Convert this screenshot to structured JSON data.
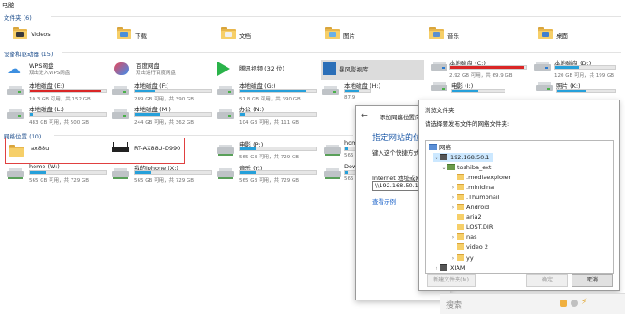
{
  "window": {
    "title_fragment": "电脑"
  },
  "groups": {
    "folders": "文件夹 (6)",
    "devices": "设备和驱动器 (15)",
    "network": "网络位置 (10)"
  },
  "folders": [
    {
      "label": "Videos"
    },
    {
      "label": "下载"
    },
    {
      "label": "文档"
    },
    {
      "label": "图片"
    },
    {
      "label": "音乐"
    },
    {
      "label": "桌面"
    }
  ],
  "apps": [
    {
      "label": "WPS网盘",
      "sub": "双击进入WPS网盘"
    },
    {
      "label": "百度网盘",
      "sub": "双击运行百度网盘"
    },
    {
      "label": "腾讯视频 (32 位)",
      "sub": ""
    },
    {
      "label": "暴风影视库",
      "sub": ""
    }
  ],
  "drives": [
    {
      "label": "本地磁盘 (C:)",
      "sub": "2.92 GB 可用，共 69.9 GB",
      "fill": 0.96,
      "red": true
    },
    {
      "label": "本地磁盘 (D:)",
      "sub": "120 GB 可用，共 199 GB",
      "fill": 0.4,
      "red": false
    },
    {
      "label": "本地磁盘 (E:)",
      "sub": "10.3 GB 可用，共 152 GB",
      "fill": 0.93,
      "red": true
    },
    {
      "label": "本地磁盘 (F:)",
      "sub": "289 GB 可用，共 390 GB",
      "fill": 0.26,
      "red": false
    },
    {
      "label": "本地磁盘 (G:)",
      "sub": "51.8 GB 可用，共 390 GB",
      "fill": 0.87,
      "red": false
    },
    {
      "label": "本地磁盘 (H:)",
      "sub": "87.9",
      "fill": 0.55,
      "red": false
    },
    {
      "label": "电影 (I:)",
      "sub": "",
      "fill": 0.5,
      "red": false
    },
    {
      "label": "照片 (K:)",
      "sub": "",
      "fill": 0.5,
      "red": false
    },
    {
      "label": "本地磁盘 (L:)",
      "sub": "483 GB 可用，共 500 GB",
      "fill": 0.03,
      "red": false
    },
    {
      "label": "本地磁盘 (M:)",
      "sub": "244 GB 可用，共 362 GB",
      "fill": 0.33,
      "red": false
    },
    {
      "label": "办公 (N:)",
      "sub": "104 GB 可用，共 111 GB",
      "fill": 0.06,
      "red": false
    }
  ],
  "network_items": [
    {
      "label": "ax88u"
    },
    {
      "label": "RT-AX88U-D990"
    },
    {
      "label": "电影 (P:)",
      "sub": "565 GB 可用，共 729 GB"
    },
    {
      "label": "home",
      "sub": "565"
    },
    {
      "label": "home (W:)",
      "sub": "565 GB 可用，共 729 GB"
    },
    {
      "label": "我的iphone (X:)",
      "sub": "565 GB 可用，共 729 GB"
    },
    {
      "label": "音乐 (Y:)",
      "sub": "565 GB 可用，共 729 GB"
    },
    {
      "label": "Down",
      "sub": "565"
    }
  ],
  "wizard": {
    "title": "添加网络位置向导",
    "heading": "指定网站的位置",
    "prompt": "键入这个快捷方式要",
    "address_label": "Internet 地址或网络",
    "address_value": "\\\\192.168.50.1",
    "browse_link": "查看示例"
  },
  "browse": {
    "title": "浏览文件夹",
    "prompt": "请选择要发布文件的网络文件夹:",
    "tree": [
      {
        "label": "网络",
        "level": 0,
        "chev": "",
        "kind": "net"
      },
      {
        "label": "192.168.50.1",
        "level": 1,
        "chev": "⌄",
        "kind": "pc",
        "selected": true
      },
      {
        "label": "toshiba_ext",
        "level": 2,
        "chev": "⌄",
        "kind": "share"
      },
      {
        "label": ".mediaexplorer",
        "level": 3,
        "chev": "",
        "kind": "folder"
      },
      {
        "label": ".minidlna",
        "level": 3,
        "chev": "›",
        "kind": "folder"
      },
      {
        "label": ".Thumbnail",
        "level": 3,
        "chev": "›",
        "kind": "folder"
      },
      {
        "label": "Android",
        "level": 3,
        "chev": "›",
        "kind": "folder"
      },
      {
        "label": "aria2",
        "level": 3,
        "chev": "",
        "kind": "folder"
      },
      {
        "label": "LOST.DIR",
        "level": 3,
        "chev": "",
        "kind": "folder"
      },
      {
        "label": "nas",
        "level": 3,
        "chev": "›",
        "kind": "folder"
      },
      {
        "label": "video 2",
        "level": 3,
        "chev": "",
        "kind": "folder"
      },
      {
        "label": "yy",
        "level": 3,
        "chev": "›",
        "kind": "folder"
      },
      {
        "label": "XIAMI",
        "level": 1,
        "chev": "›",
        "kind": "pc"
      }
    ],
    "new_folder": "新建文件夹(M)",
    "ok": "确定",
    "cancel": "取消"
  },
  "taskbar": {
    "search_placeholder": "搜索"
  },
  "colors": {
    "accent": "#26a0da",
    "warn": "#da2626",
    "highlight": "#e04040",
    "folder": "#f6cf69"
  }
}
